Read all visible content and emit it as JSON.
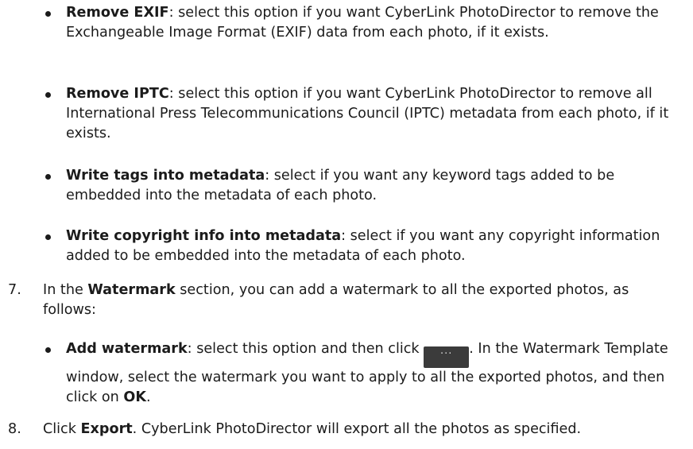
{
  "bullets": [
    {
      "term": "Remove EXIF",
      "rest": ": select this option if you want CyberLink PhotoDirector to remove the Exchangeable Image Format (EXIF) data from each photo, if it exists."
    },
    {
      "term": "Remove IPTC",
      "rest": ": select this option if you want CyberLink PhotoDirector to remove all International Press Telecommunications Council (IPTC) metadata from each photo, if it exists."
    },
    {
      "term": "Write tags into metadata",
      "rest": ": select if you want any keyword tags added to be embedded into the metadata of each photo."
    },
    {
      "term": "Write copyright info into metadata",
      "rest": ": select if you want any copyright information added to be embedded into the metadata of each photo."
    }
  ],
  "step7": {
    "number": "7.",
    "pre": "In the ",
    "bold": "Watermark",
    "post": " section, you can add a watermark to all the exported photos, as follows:"
  },
  "watermark_bullet": {
    "term": "Add watermark",
    "pre": ": select this option and then click ",
    "button_label": "···",
    "post": ". In the Watermark Template window, select the watermark you want to apply to all the exported photos, and then click on ",
    "ok": "OK",
    "end": "."
  },
  "step8": {
    "number": "8.",
    "pre": "Click ",
    "bold": "Export",
    "post": ". CyberLink PhotoDirector will export all the photos as specified."
  }
}
